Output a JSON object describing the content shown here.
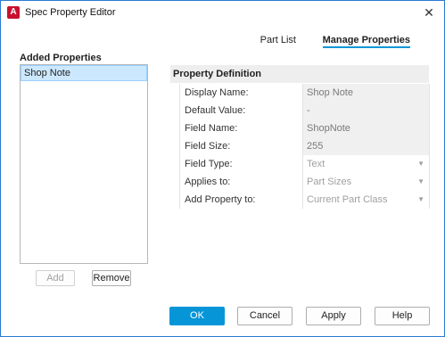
{
  "window": {
    "title": "Spec Property Editor",
    "app_icon_glyph": "A",
    "close_glyph": "✕"
  },
  "tabs": [
    {
      "label": "Part List",
      "active": false
    },
    {
      "label": "Manage Properties",
      "active": true
    }
  ],
  "added_properties": {
    "heading": "Added Properties",
    "items": [
      {
        "label": "Shop Note",
        "selected": true
      }
    ],
    "add_label": "Add",
    "remove_label": "Remove"
  },
  "property_definition": {
    "heading": "Property Definition",
    "rows": [
      {
        "key": "Display Name:",
        "value": "Shop Note"
      },
      {
        "key": "Default Value:",
        "value": "-"
      },
      {
        "key": "Field Name:",
        "value": "ShopNote"
      },
      {
        "key": "Field Size:",
        "value": "255"
      },
      {
        "key": "Field Type:",
        "value": "Text",
        "dropdown": true
      },
      {
        "key": "Applies to:",
        "value": "Part Sizes",
        "dropdown": true
      },
      {
        "key": "Add Property to:",
        "value": "Current Part Class",
        "dropdown": true
      }
    ]
  },
  "footer": {
    "ok": "OK",
    "cancel": "Cancel",
    "apply": "Apply",
    "help": "Help"
  },
  "colors": {
    "accent": "#0696d7",
    "app_icon": "#c8102e",
    "selection": "#cce8ff"
  }
}
